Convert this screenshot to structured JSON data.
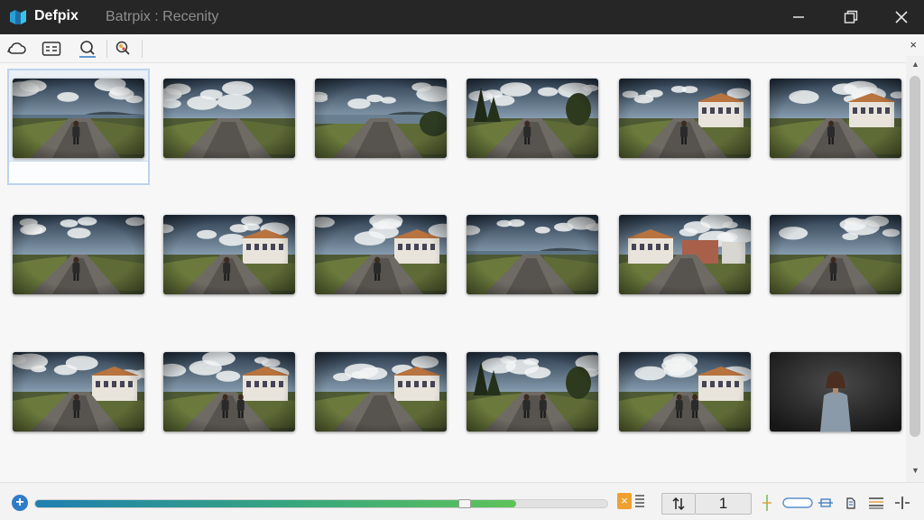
{
  "titlebar": {
    "app_name": "Defpix",
    "doc_title": "Batrpix : Recenity"
  },
  "toolbar": {
    "tools": [
      "cloud-back-icon",
      "id-card-icon",
      "search-icon",
      "find-color-icon"
    ],
    "close_label": "×"
  },
  "gallery": {
    "selected_index": 0,
    "rows": [
      [
        "lakeside-path-person",
        "road-through-fields",
        "lakeshore-cliffs",
        "forest-path-person",
        "village-road-person",
        "village-houses-person"
      ],
      [
        "field-road-person",
        "townhouse-street-person",
        "villa-road-person",
        "lake-path-rocks",
        "town-plaza-buildings",
        "field-path-person"
      ],
      [
        "villa-lane-person",
        "villa-walkers-pair",
        "villa-roundabout",
        "trees-road-walkers",
        "villa-walkers-trio",
        "studio-portrait-woman"
      ]
    ]
  },
  "statusbar": {
    "add_label": "+",
    "progress": 0.84,
    "handle_position": 0.75,
    "orange_label": "×",
    "page_number": "1"
  },
  "colors": {
    "titlebar": "#262626",
    "accent_blue": "#2f7bc7",
    "progress_start": "#1f7fb0",
    "progress_end": "#5ec35a",
    "orange": "#f0a030"
  }
}
